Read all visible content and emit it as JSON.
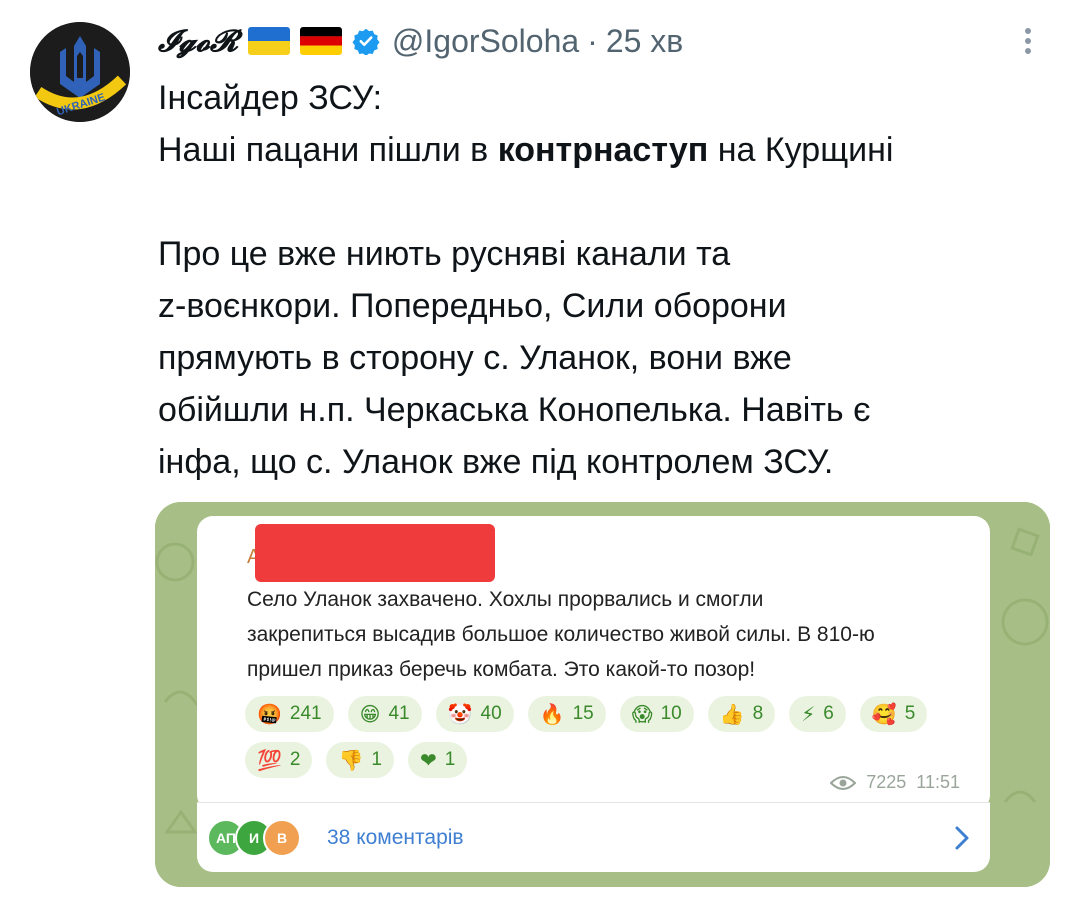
{
  "tweet": {
    "author_name": "𝓘𝓰𝓸𝓡",
    "handle": "@IgorSoloha",
    "separator": "·",
    "time": "25 хв",
    "avatar_text": "UKRAINE",
    "lines": [
      "Інсайдер ЗСУ:",
      [
        "Наші пацани пішли в ",
        "контрнаступ",
        " на Курщині"
      ],
      "",
      "Про це вже ниють русняві канали та",
      "z-воєнкори. Попередньо, Сили оборони",
      "прямують в сторону с. Уланок, вони вже",
      "обійшли н.п. Черкаська Конопелька. Навіть є",
      "інфа, що с. Уланок вже під контролем ЗСУ."
    ]
  },
  "media": {
    "sender_visible": "A",
    "message_lines": [
      "Село Уланок захвачено. Хохлы прорвались и смогли",
      "закрепиться высадив большое количество живой силы. В 810-ю",
      "пришел приказ беречь комбата. Это какой-то позор!"
    ],
    "reactions_row1": [
      {
        "emoji": "🤬",
        "count": "241"
      },
      {
        "emoji": "😁",
        "count": "41"
      },
      {
        "emoji": "🤡",
        "count": "40"
      },
      {
        "emoji": "🔥",
        "count": "15"
      },
      {
        "emoji": "😱",
        "count": "10"
      },
      {
        "emoji": "👍",
        "count": "8"
      },
      {
        "emoji": "⚡",
        "count": "6"
      },
      {
        "emoji": "🥰",
        "count": "5"
      }
    ],
    "reactions_row2": [
      {
        "emoji": "💯",
        "count": "2"
      },
      {
        "emoji": "👎",
        "count": "1"
      },
      {
        "emoji": "❤",
        "count": "1"
      }
    ],
    "views": "7225",
    "timestamp": "11:51",
    "commenter_initials": [
      "АП",
      "И",
      "В"
    ],
    "comments_label": "38 коментарів"
  },
  "colors": {
    "verified_blue": "#1d9bf0",
    "reaction_bg": "#eaf3e0",
    "reaction_text": "#3a8a2c",
    "comments_link": "#3f7fd1"
  },
  "icons": {
    "more": "more-vertical-icon",
    "verified": "verified-badge-icon",
    "views": "eye-icon",
    "chevron": "chevron-right-icon"
  }
}
